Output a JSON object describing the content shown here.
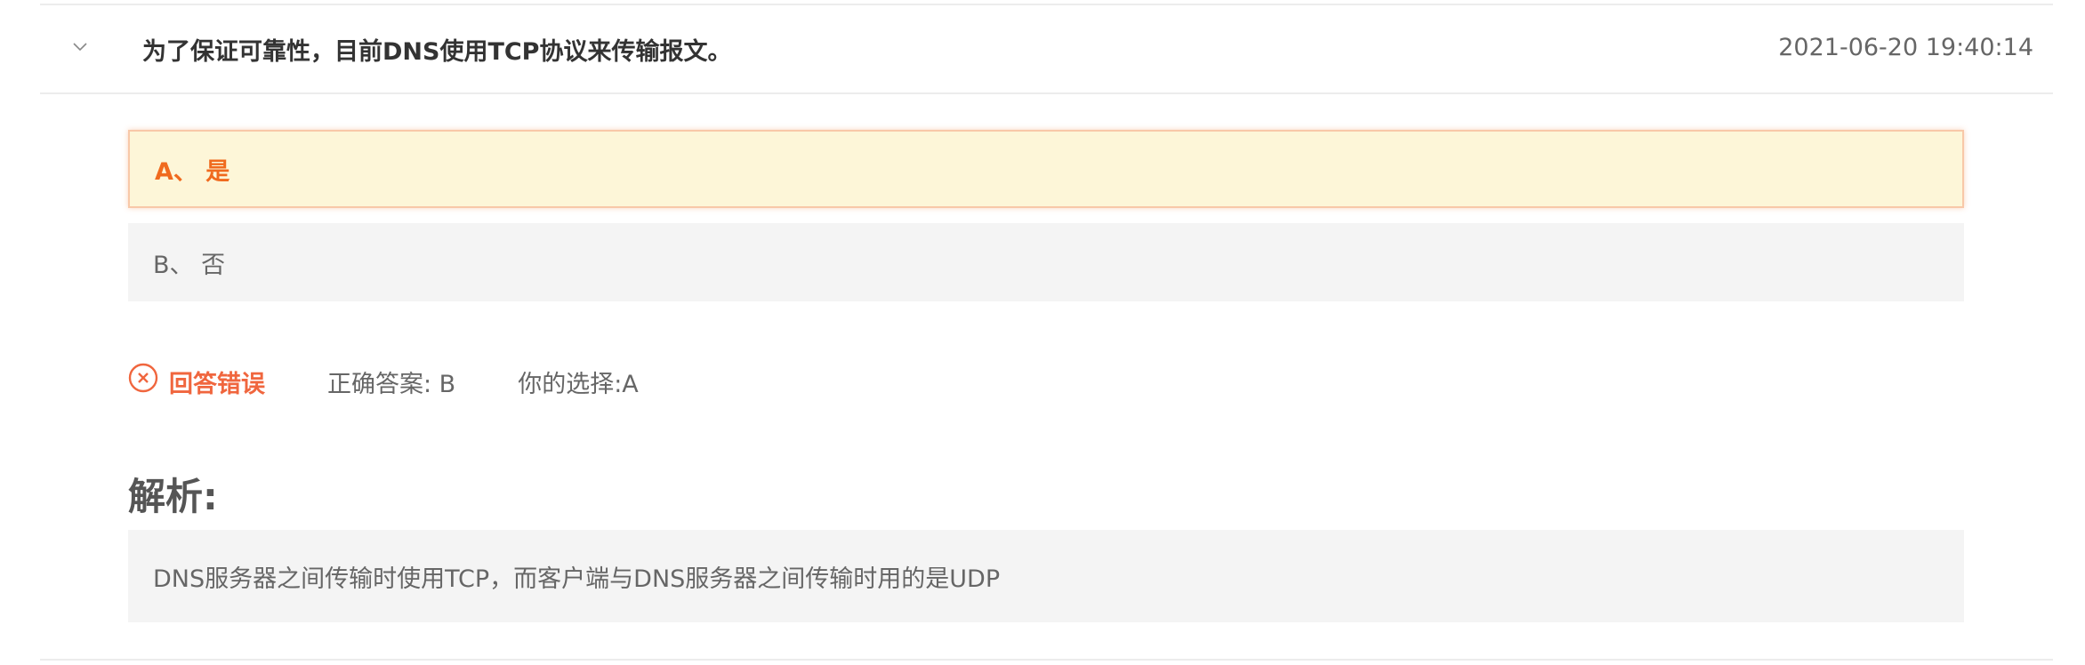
{
  "question": {
    "text": "为了保证可靠性，目前DNS使用TCP协议来传输报文。",
    "timestamp": "2021-06-20 19:40:14",
    "expand_icon": "chevron-down-icon"
  },
  "options": [
    {
      "label": "A、 是",
      "state": "selected-wrong"
    },
    {
      "label": "B、 否",
      "state": "normal"
    }
  ],
  "result": {
    "status_icon": "circle-x-icon",
    "status_text": "回答错误",
    "correct_answer": "正确答案: B",
    "your_choice": "你的选择:A"
  },
  "analysis": {
    "title": "解析:",
    "text": "DNS服务器之间传输时使用TCP，而客户端与DNS服务器之间传输时用的是UDP"
  },
  "colors": {
    "accent_orange": "#f06a1e",
    "selected_bg": "#fdf6d8",
    "error_red": "#f0663e",
    "option_bg": "#f4f4f4"
  }
}
